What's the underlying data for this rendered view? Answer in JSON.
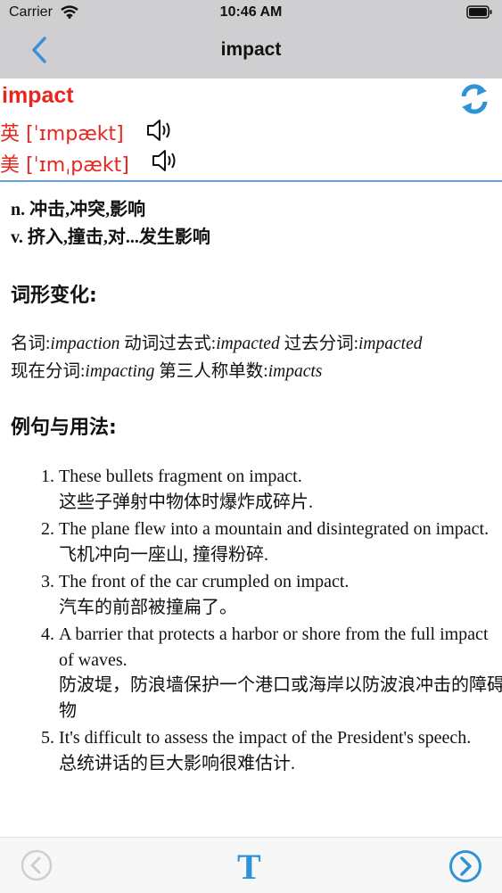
{
  "status": {
    "carrier": "Carrier",
    "time": "10:46 AM"
  },
  "nav": {
    "title": "impact"
  },
  "entry": {
    "word": "impact",
    "uk": "英 [ˈɪmpækt]",
    "us": "美 [ˈɪmˌpækt]"
  },
  "definitions": [
    {
      "pos": "n.",
      "text": "冲击,冲突,影响"
    },
    {
      "pos": "v.",
      "text": "挤入,撞击,对...发生影响"
    }
  ],
  "forms_heading": "词形变化:",
  "forms": [
    {
      "label": "名词:",
      "value": "impaction"
    },
    {
      "label": "动词过去式:",
      "value": "impacted"
    },
    {
      "label": "过去分词:",
      "value": "impacted"
    },
    {
      "label": "现在分词:",
      "value": "impacting"
    },
    {
      "label": "第三人称单数:",
      "value": "impacts"
    }
  ],
  "examples_heading": "例句与用法:",
  "examples": [
    {
      "en": "These bullets fragment on impact.",
      "zh": "这些子弹射中物体时爆炸成碎片."
    },
    {
      "en": "The plane flew into a mountain and disintegrated on impact.",
      "zh": "飞机冲向一座山, 撞得粉碎."
    },
    {
      "en": "The front of the car crumpled on impact.",
      "zh": "汽车的前部被撞扁了。"
    },
    {
      "en": "A barrier that protects a harbor or shore from the full impact of waves.",
      "zh": "防波堤，防浪墙保护一个港口或海岸以防波浪冲击的障碍物"
    },
    {
      "en": "It's difficult to assess the impact of the President's speech.",
      "zh": "总统讲话的巨大影响很难估计."
    }
  ],
  "toolbar": {
    "text_button": "T"
  },
  "colors": {
    "accent": "#2f93d8",
    "word": "#e8261d"
  }
}
